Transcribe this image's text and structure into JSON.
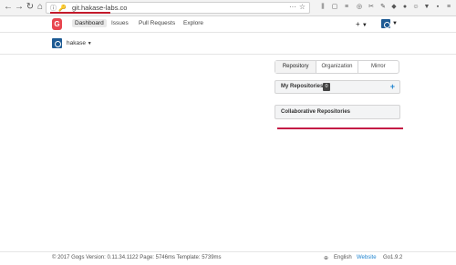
{
  "browser": {
    "url": "git.hakase-labs.co",
    "info_icon": "info-icon",
    "key_icon": "key-icon"
  },
  "header": {
    "logo_text": "G",
    "nav": [
      {
        "label": "Dashboard",
        "active": true
      },
      {
        "label": "Issues",
        "active": false
      },
      {
        "label": "Pull Requests",
        "active": false
      },
      {
        "label": "Explore",
        "active": false
      }
    ],
    "plus_label": "+"
  },
  "context": {
    "user": "hakase"
  },
  "tabs": [
    {
      "label": "Repository",
      "active": true
    },
    {
      "label": "Organization",
      "active": false
    },
    {
      "label": "Mirror",
      "active": false
    }
  ],
  "my_repos": {
    "title": "My Repositories",
    "count": "0",
    "add_label": "+"
  },
  "collab": {
    "title": "Collaborative Repositories"
  },
  "footer": {
    "version": "© 2017 Gogs Version: 0.11.34.1122 Page: 5746ms Template: 5739ms",
    "language": "English",
    "website": "Website",
    "go_version": "Go1.9.2"
  },
  "colors": {
    "accent_red": "#c41a2b",
    "logo_red": "#e8464f",
    "avatar_blue": "#1e5b94",
    "link_blue": "#2185d0"
  }
}
